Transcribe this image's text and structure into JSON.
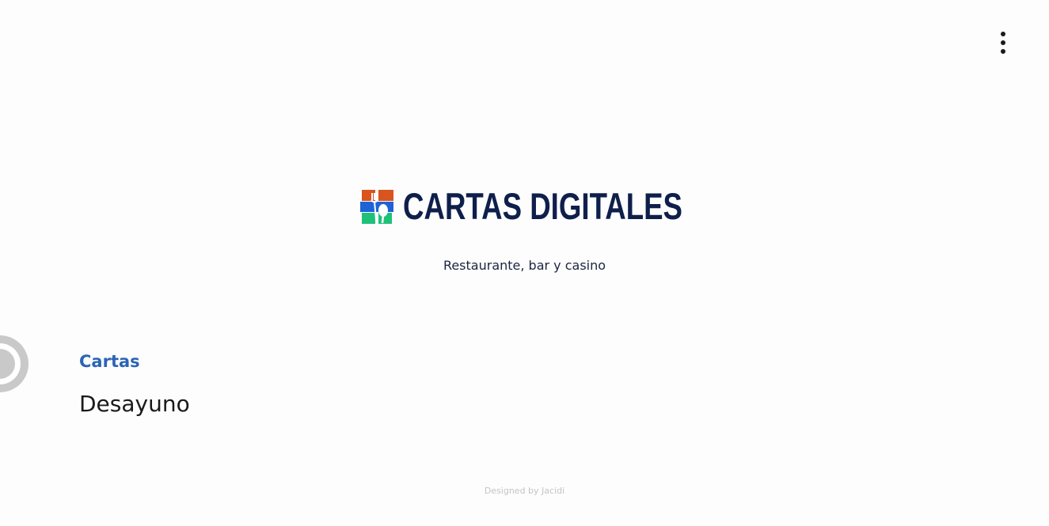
{
  "header": {
    "menu_icon": "more-vertical-icon"
  },
  "brand": {
    "logo_icon": "cutlery-logo-icon",
    "name": "CARTAS DIGITALES",
    "colors": {
      "navy": "#0f1f4b",
      "orange": "#d9541e",
      "blue": "#1e63d6",
      "green": "#1fc17a"
    }
  },
  "subtitle": "Restaurante, bar y casino",
  "side_widget": {
    "icon": "circle-toggle-icon"
  },
  "menus": {
    "section_title": "Cartas",
    "accent_color": "#2b64b5",
    "items": [
      {
        "label": "Desayuno"
      }
    ]
  },
  "footer": {
    "credit": "Designed by Jacidi"
  }
}
